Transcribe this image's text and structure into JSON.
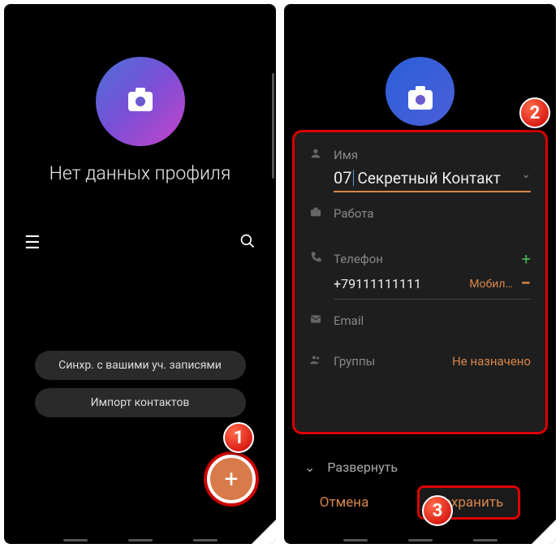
{
  "left": {
    "no_profile_text": "Нет данных профиля",
    "sync_button": "Синхр. с вашими уч. записями",
    "import_button": "Импорт контактов",
    "fab_label": "+"
  },
  "right": {
    "name_label": "Имя",
    "name_prefix": "07",
    "name_rest": "Секретный Контакт",
    "work_label": "Работа",
    "phone_label": "Телефон",
    "phone_value": "+79111111111",
    "phone_type": "Мобил…",
    "email_label": "Email",
    "groups_label": "Группы",
    "groups_value": "Не назначено",
    "expand_label": "Развернуть",
    "cancel_label": "Отмена",
    "save_label": "Сохранить"
  },
  "badges": {
    "b1": "1",
    "b2": "2",
    "b3": "3"
  }
}
